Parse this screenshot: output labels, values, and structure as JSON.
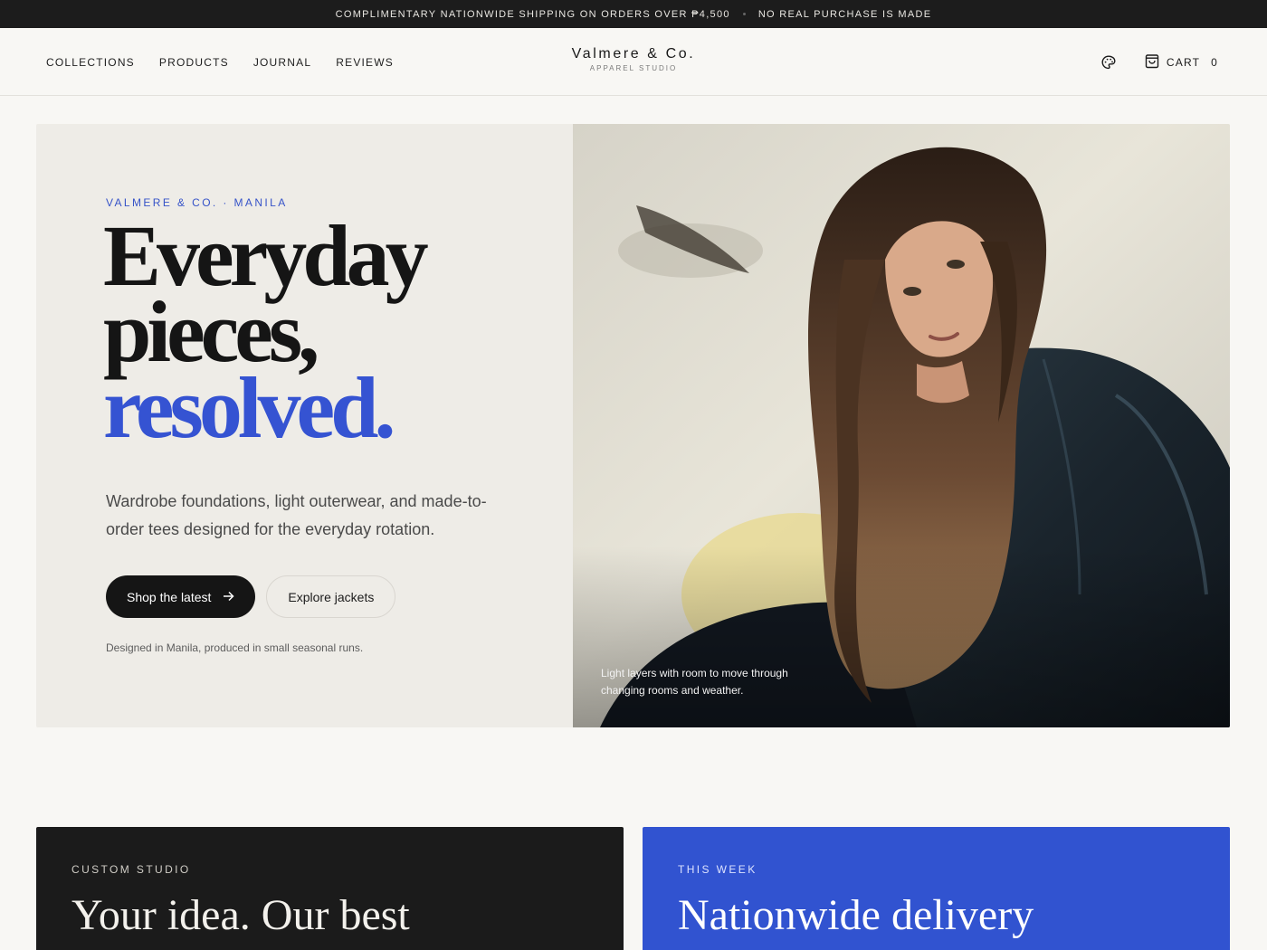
{
  "announcement": {
    "shipping": "COMPLIMENTARY NATIONWIDE SHIPPING ON ORDERS OVER ₱4,500",
    "notice": "NO REAL PURCHASE IS MADE"
  },
  "nav": {
    "items": [
      {
        "label": "COLLECTIONS"
      },
      {
        "label": "PRODUCTS"
      },
      {
        "label": "JOURNAL"
      },
      {
        "label": "REVIEWS"
      }
    ]
  },
  "brand": {
    "name": "Valmere & Co.",
    "tagline": "APPAREL STUDIO"
  },
  "header_actions": {
    "theme_icon": "palette-icon",
    "cart_icon": "shopping-bag-icon",
    "cart_label": "CART",
    "cart_count": "0"
  },
  "hero": {
    "eyebrow": "VALMERE & CO. · MANILA",
    "headline_line1": "Everyday",
    "headline_line2": "pieces,",
    "headline_accent": "resolved.",
    "lede": "Wardrobe foundations, light outerwear, and made-to-order tees designed for the everyday rotation.",
    "primary_cta": "Shop the latest",
    "primary_cta_icon": "arrow-right-icon",
    "secondary_cta": "Explore jackets",
    "fine_print": "Designed in Manila, produced in small seasonal runs.",
    "image_caption": "Light layers with room to move through changing rooms and weather."
  },
  "cards": [
    {
      "kicker": "CUSTOM STUDIO",
      "title": "Your idea. Our best"
    },
    {
      "kicker": "THIS WEEK",
      "title": "Nationwide delivery"
    }
  ],
  "colors": {
    "accent": "#3553d2",
    "dark": "#1b1b1b",
    "background": "#f8f7f4",
    "hero_panel": "#eeece7"
  }
}
